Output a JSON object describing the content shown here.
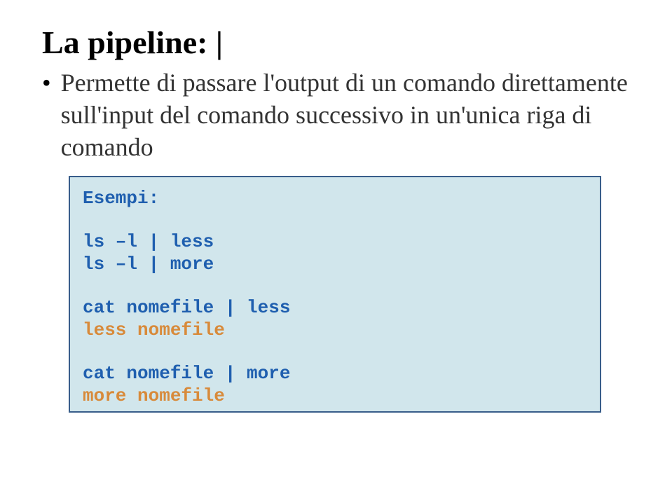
{
  "title": "La pipeline: |",
  "bullet_text": "Permette di passare l'output di un comando direttamente sull'input del comando successivo in un'unica riga di comando",
  "examples_label": "Esempi:",
  "group1": {
    "line1": "ls –l | less",
    "line2": "ls –l | more"
  },
  "group2": {
    "line1": "cat nomefile | less",
    "line2": "less nomefile"
  },
  "group3": {
    "line1": "cat nomefile | more",
    "line2": "more nomefile"
  }
}
